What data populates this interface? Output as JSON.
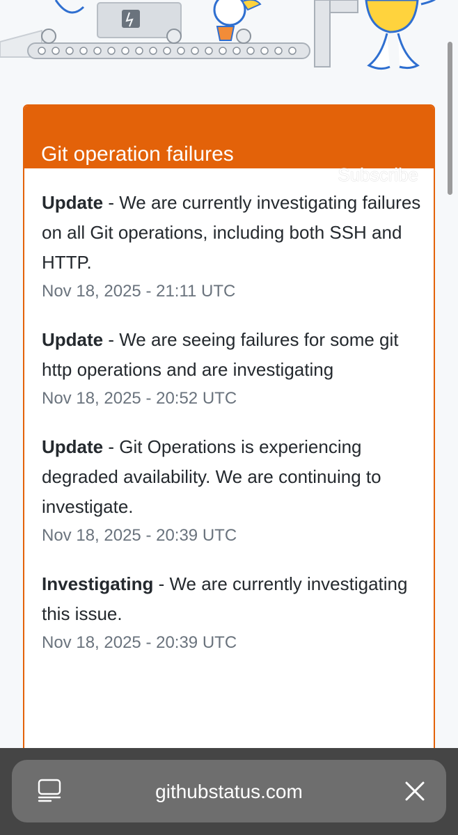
{
  "incident": {
    "title": "Git operation failures",
    "subscribe_label": "Subscribe",
    "accent_color": "#e36209",
    "updates": [
      {
        "status": "Update",
        "message": " - We are currently investigating failures on all Git operations, including both SSH and HTTP.",
        "time": "Nov 18, 2025 - 21:11 UTC"
      },
      {
        "status": "Update",
        "message": " - We are seeing failures for some git http operations and are investigating",
        "time": "Nov 18, 2025 - 20:52 UTC"
      },
      {
        "status": "Update",
        "message": " - Git Operations is experiencing degraded availability. We are continuing to investigate.",
        "time": "Nov 18, 2025 - 20:39 UTC"
      },
      {
        "status": "Investigating",
        "message": " - We are currently investigating this issue.",
        "time": "Nov 18, 2025 - 20:39 UTC"
      }
    ]
  },
  "browser": {
    "url": "githubstatus.com",
    "tabs_icon": "tabs-overview-icon",
    "close_icon": "close-icon"
  }
}
